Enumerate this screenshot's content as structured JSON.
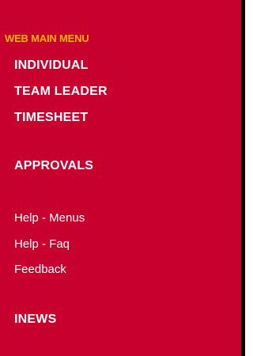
{
  "menu": {
    "title": "WEB MAIN MENU",
    "items": [
      {
        "label": "INDIVIDUAL"
      },
      {
        "label": "TEAM LEADER"
      },
      {
        "label": "TIMESHEET"
      },
      {
        "label": "APPROVALS"
      }
    ],
    "links": [
      {
        "label": "Help - Menus"
      },
      {
        "label": "Help - Faq"
      },
      {
        "label": "Feedback"
      }
    ],
    "news": {
      "label": "INEWS"
    }
  },
  "colors": {
    "panel_background": "#c8002d",
    "title_text": "#ffb000",
    "item_text": "#ffffff",
    "right_border": "#000000"
  }
}
